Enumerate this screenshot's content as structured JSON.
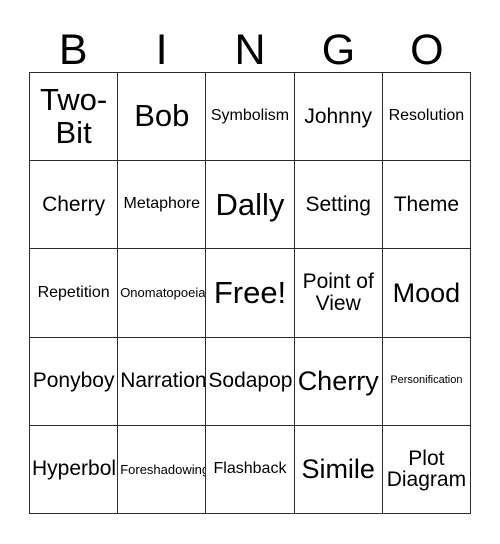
{
  "card": {
    "type": "bingo-card",
    "title_letters": [
      "B",
      "I",
      "N",
      "G",
      "O"
    ],
    "columns": 5,
    "rows": 5,
    "free_space_label": "Free!",
    "free_space_position": "center",
    "colors": {
      "background": "#ffffff",
      "text": "#000000",
      "grid_line": "#2b2b2b"
    },
    "cells": [
      {
        "text": "Two-Bit",
        "size": "xl",
        "row": 1,
        "col": 1
      },
      {
        "text": "Bob",
        "size": "xl",
        "row": 1,
        "col": 2
      },
      {
        "text": "Symbolism",
        "size": "sm",
        "row": 1,
        "col": 3
      },
      {
        "text": "Johnny",
        "size": "md",
        "row": 1,
        "col": 4
      },
      {
        "text": "Resolution",
        "size": "sm",
        "row": 1,
        "col": 5
      },
      {
        "text": "Cherry",
        "size": "md",
        "row": 2,
        "col": 1
      },
      {
        "text": "Metaphore",
        "size": "sm",
        "row": 2,
        "col": 2
      },
      {
        "text": "Dally",
        "size": "xl",
        "row": 2,
        "col": 3
      },
      {
        "text": "Setting",
        "size": "md",
        "row": 2,
        "col": 4
      },
      {
        "text": "Theme",
        "size": "md",
        "row": 2,
        "col": 5
      },
      {
        "text": "Repetition",
        "size": "sm",
        "row": 3,
        "col": 1
      },
      {
        "text": "Onomatopoeia",
        "size": "xs",
        "row": 3,
        "col": 2
      },
      {
        "text": "Free!",
        "size": "xl",
        "row": 3,
        "col": 3
      },
      {
        "text": "Point of View",
        "size": "md",
        "row": 3,
        "col": 4
      },
      {
        "text": "Mood",
        "size": "lg",
        "row": 3,
        "col": 5
      },
      {
        "text": "Ponyboy",
        "size": "md",
        "row": 4,
        "col": 1
      },
      {
        "text": "Narration",
        "size": "md",
        "row": 4,
        "col": 2
      },
      {
        "text": "Sodapop",
        "size": "md",
        "row": 4,
        "col": 3
      },
      {
        "text": "Cherry",
        "size": "lg",
        "row": 4,
        "col": 4
      },
      {
        "text": "Personification",
        "size": "xxs",
        "row": 4,
        "col": 5
      },
      {
        "text": "Hyperbole",
        "size": "md",
        "row": 5,
        "col": 1
      },
      {
        "text": "Foreshadowing",
        "size": "xs",
        "row": 5,
        "col": 2
      },
      {
        "text": "Flashback",
        "size": "sm",
        "row": 5,
        "col": 3
      },
      {
        "text": "Simile",
        "size": "lg",
        "row": 5,
        "col": 4
      },
      {
        "text": "Plot Diagram",
        "size": "md",
        "row": 5,
        "col": 5
      }
    ]
  }
}
